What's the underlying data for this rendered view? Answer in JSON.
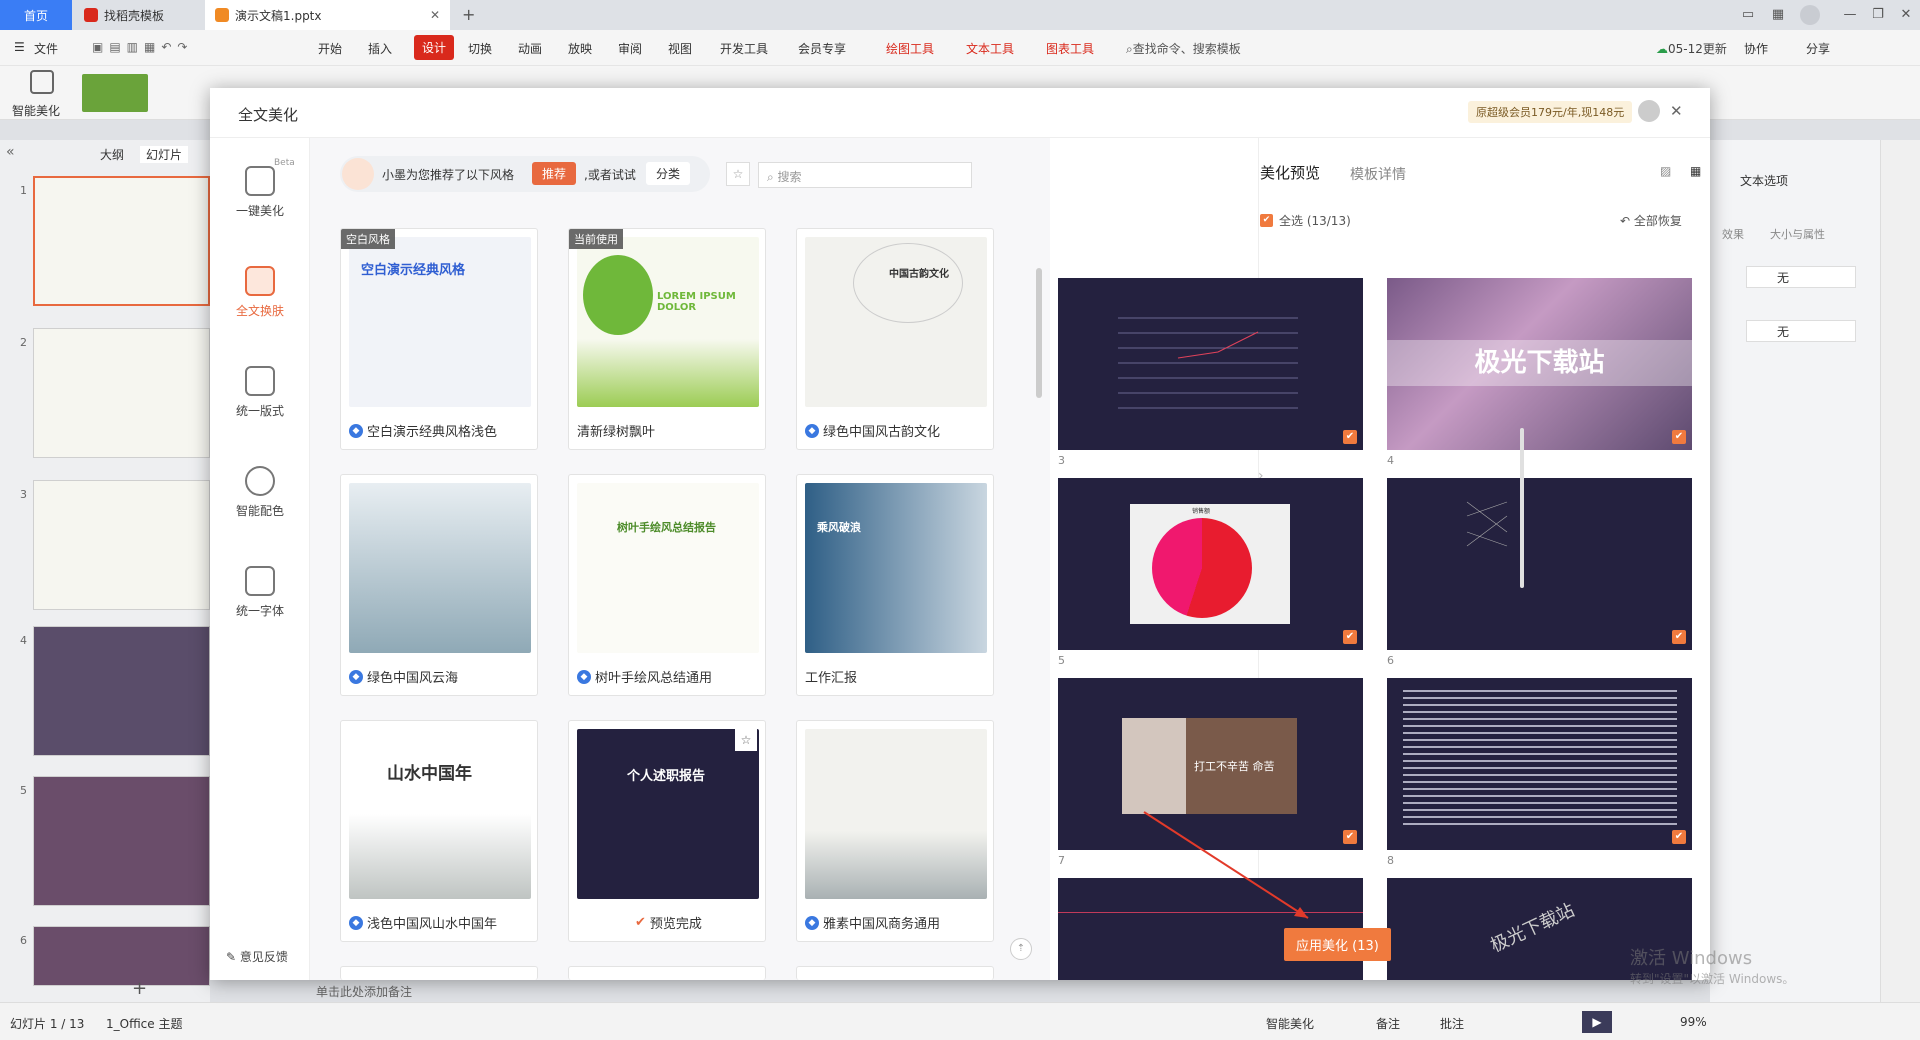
{
  "tabs": {
    "home": "首页",
    "t1": "找稻壳模板",
    "t2": "演示文稿1.pptx",
    "new_tab": "+"
  },
  "menu": {
    "file": "文件",
    "items": [
      "开始",
      "插入",
      "设计",
      "切换",
      "动画",
      "放映",
      "审阅",
      "视图",
      "开发工具",
      "会员专享"
    ],
    "tool_items": [
      "绘图工具",
      "文本工具",
      "图表工具"
    ],
    "search": "查找命令、搜索模板",
    "update": "05-12更新",
    "collab": "协作",
    "share": "分享"
  },
  "ribbon": {
    "smart_beautify": "智能美化"
  },
  "leftpane": {
    "outline": "大纲",
    "slides": "幻灯片",
    "add": "+"
  },
  "statusbar": {
    "slide_info": "幻灯片 1 / 13",
    "theme": "1_Office 主题",
    "smart": "智能美化",
    "notes": "备注",
    "comments": "批注",
    "zoom": "99%",
    "add_notes": "单击此处添加备注"
  },
  "rightpane": {
    "title": "文本选项",
    "effect": "效果",
    "size": "大小与属性",
    "none1": "无",
    "none2": "无"
  },
  "dialog": {
    "title": "全文美化",
    "promo": "原超级会员179元/年,现148元",
    "nav": [
      {
        "label": "一键美化",
        "beta": "Beta"
      },
      {
        "label": "全文换肤"
      },
      {
        "label": "统一版式"
      },
      {
        "label": "智能配色"
      },
      {
        "label": "统一字体"
      }
    ],
    "feedback": "意见反馈",
    "recommend_text": "小墨为您推荐了以下风格",
    "recommend_btn": "推荐",
    "or_try": ",或者试试",
    "classify": "分类",
    "search_placeholder": "搜索",
    "templates": [
      {
        "name": "空白演示经典风格浅色",
        "badge": "空白风格",
        "vip": true,
        "thumb_title": "空白演示经典风格"
      },
      {
        "name": "清新绿树飘叶",
        "badge": "当前使用",
        "vip": false,
        "thumb_title": "LOREM IPSUM DOLOR"
      },
      {
        "name": "绿色中国风古韵文化",
        "vip": true,
        "thumb_title": "中国古韵文化"
      },
      {
        "name": "绿色中国风云海",
        "vip": true,
        "thumb_title": ""
      },
      {
        "name": "树叶手绘风总结通用",
        "vip": true,
        "thumb_title": "树叶手绘风总结报告"
      },
      {
        "name": "工作汇报",
        "vip": false,
        "thumb_title": "乘风破浪"
      },
      {
        "name": "浅色中国风山水中国年",
        "vip": true,
        "thumb_title": "山水中国年"
      },
      {
        "name": "预览完成",
        "vip": false,
        "done": true,
        "thumb_title": "个人述职报告"
      },
      {
        "name": "雅素中国风商务通用",
        "vip": true,
        "thumb_title": ""
      }
    ],
    "preview_tab": "美化预览",
    "detail_tab": "模板详情",
    "select_all": "全选 (13/13)",
    "restore": "全部恢复",
    "preview_nums": [
      "3",
      "4",
      "5",
      "6",
      "7",
      "8"
    ],
    "watermark_text": "极光下载站",
    "pie_title": "销售额",
    "slide7_text": "打工不辛苦 命苦",
    "apply_btn": "应用美化 (13)",
    "activate": "激活 Windows",
    "activate_sub": "转到\"设置\"以激活 Windows。"
  },
  "colors": {
    "accent": "#e8693f",
    "wps_red": "#d9291c",
    "dark_slide": "#24213f",
    "tab_blue": "#3a7df5"
  }
}
